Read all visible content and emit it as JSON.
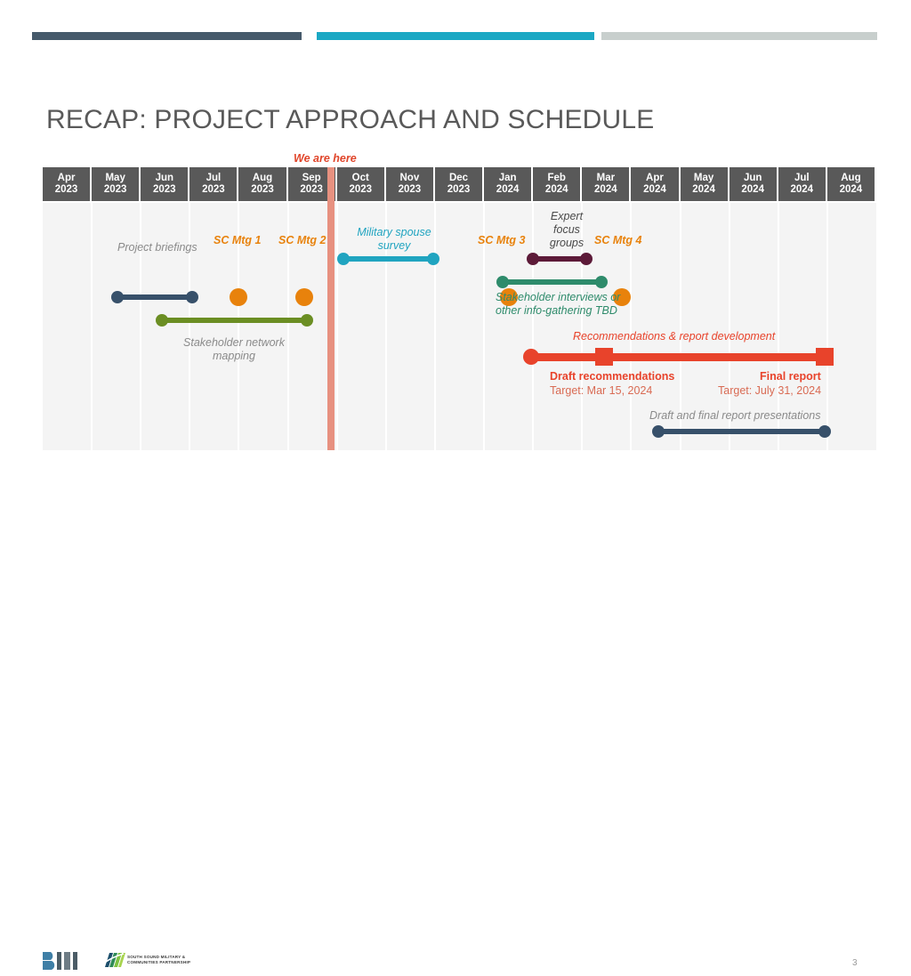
{
  "slide": {
    "title": "RECAP: PROJECT APPROACH AND SCHEDULE",
    "page_number": "3"
  },
  "colors": {
    "bar_dark_slate": "#465A6B",
    "bar_teal": "#1BA8C4",
    "bar_gray": "#C8CFCD",
    "header_cell": "#595959",
    "body_bg": "#F4F4F4",
    "marker_salmon": "#E79180",
    "marker_label_red": "#E0452A",
    "orange": "#E8820C",
    "olive": "#6B8E23",
    "cyan": "#20A4C0",
    "maroon": "#5C1A38",
    "teal_green": "#2E8B6B",
    "red": "#E8432B",
    "slate": "#37506A",
    "label_gray": "#8A8A8A"
  },
  "timeline": {
    "marker": {
      "label": "We are here",
      "at_month": "Sep 2023"
    },
    "months": [
      {
        "month": "Apr",
        "year": "2023"
      },
      {
        "month": "May",
        "year": "2023"
      },
      {
        "month": "Jun",
        "year": "2023"
      },
      {
        "month": "Jul",
        "year": "2023"
      },
      {
        "month": "Aug",
        "year": "2023"
      },
      {
        "month": "Sep",
        "year": "2023"
      },
      {
        "month": "Oct",
        "year": "2023"
      },
      {
        "month": "Nov",
        "year": "2023"
      },
      {
        "month": "Dec",
        "year": "2023"
      },
      {
        "month": "Jan",
        "year": "2024"
      },
      {
        "month": "Feb",
        "year": "2024"
      },
      {
        "month": "Mar",
        "year": "2024"
      },
      {
        "month": "Apr",
        "year": "2024"
      },
      {
        "month": "May",
        "year": "2024"
      },
      {
        "month": "Jun",
        "year": "2024"
      },
      {
        "month": "Jul",
        "year": "2024"
      },
      {
        "month": "Aug",
        "year": "2024"
      }
    ]
  },
  "chart_data": {
    "type": "bar",
    "title": "RECAP: PROJECT APPROACH AND SCHEDULE",
    "xlabel": "",
    "ylabel": "",
    "categories": [
      "Apr 2023",
      "May 2023",
      "Jun 2023",
      "Jul 2023",
      "Aug 2023",
      "Sep 2023",
      "Oct 2023",
      "Nov 2023",
      "Dec 2023",
      "Jan 2024",
      "Feb 2024",
      "Mar 2024",
      "Apr 2024",
      "May 2024",
      "Jun 2024",
      "Jul 2024",
      "Aug 2024"
    ],
    "tasks": [
      {
        "name": "Project briefings",
        "start": "Apr 2023",
        "end": "Jun 2023",
        "color": "#37506A",
        "kind": "bar"
      },
      {
        "name": "Stakeholder network mapping",
        "start": "May 2023",
        "end": "Aug 2023",
        "color": "#6B8E23",
        "kind": "bar"
      },
      {
        "name": "SC Mtg 1",
        "at": "Jul 2023",
        "color": "#E8820C",
        "kind": "milestone-dot"
      },
      {
        "name": "SC Mtg 2",
        "at": "Aug 2023",
        "color": "#E8820C",
        "kind": "milestone-dot"
      },
      {
        "name": "Military spouse survey",
        "start": "Oct 2023",
        "end": "Dec 2023",
        "color": "#20A4C0",
        "kind": "bar"
      },
      {
        "name": "SC Mtg 3",
        "at": "Jan 2024",
        "color": "#E8820C",
        "kind": "milestone-dot"
      },
      {
        "name": "Expert focus groups",
        "start": "Feb 2024",
        "end": "Mar 2024",
        "color": "#5C1A38",
        "kind": "bar"
      },
      {
        "name": "Stakeholder interviews or other info-gathering TBD",
        "start": "Feb 2024",
        "end": "Mar 2024",
        "color": "#2E8B6B",
        "kind": "bar"
      },
      {
        "name": "SC Mtg 4",
        "at": "Apr 2024",
        "color": "#E8820C",
        "kind": "milestone-dot"
      },
      {
        "name": "Recommendations & report development",
        "start": "Feb 2024",
        "end": "Aug 2024",
        "color": "#E8432B",
        "kind": "bar"
      },
      {
        "name": "Draft and final report presentations",
        "start": "May 2024",
        "end": "Aug 2024",
        "color": "#37506A",
        "kind": "bar"
      }
    ],
    "milestones": [
      {
        "name": "Draft recommendations",
        "target": "Target: Mar 15, 2024",
        "at": "Mar 2024",
        "color": "#E8432B"
      },
      {
        "name": "Final report",
        "target": "Target: July 31, 2024",
        "at": "Jul 2024",
        "color": "#E8432B"
      }
    ]
  },
  "tasks": {
    "project_briefings": "Project briefings",
    "stakeholder_mapping": "Stakeholder network\nmapping",
    "stakeholder_mapping_l1": "Stakeholder network",
    "stakeholder_mapping_l2": "mapping",
    "sc_mtg_1": "SC Mtg 1",
    "sc_mtg_2": "SC Mtg 2",
    "sc_mtg_3": "SC Mtg 3",
    "sc_mtg_4": "SC Mtg 4",
    "military_survey_l1": "Military spouse",
    "military_survey_l2": "survey",
    "expert_focus_l1": "Expert",
    "expert_focus_l2": "focus",
    "expert_focus_l3": "groups",
    "stakeholder_interviews_l1": "Stakeholder interviews or",
    "stakeholder_interviews_l2": "other info-gathering TBD",
    "recommendations_dev": "Recommendations & report development",
    "draft_rec_title": "Draft recommendations",
    "draft_rec_target": "Target: Mar 15, 2024",
    "final_report_title": "Final report",
    "final_report_target": "Target: July 31, 2024",
    "report_presentations": "Draft and final report presentations"
  },
  "footer": {
    "logo_bii": "BII",
    "ssmcp_line1": "SOUTH SOUND MILITARY &",
    "ssmcp_line2": "COMMUNITIES PARTNERSHIP"
  }
}
